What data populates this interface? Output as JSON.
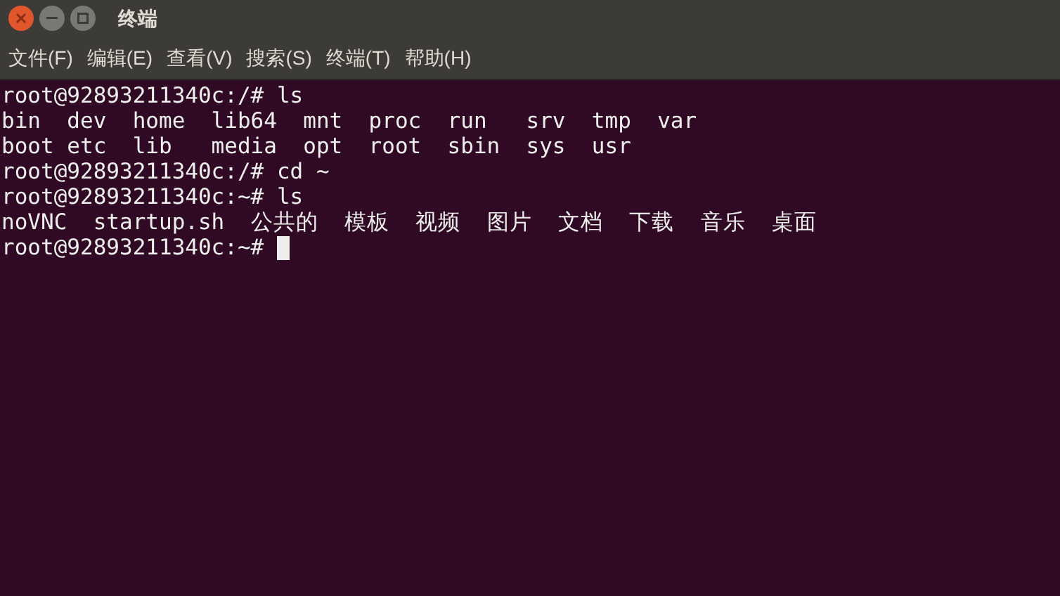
{
  "window": {
    "title": "终端"
  },
  "menu": [
    "文件(F)",
    "编辑(E)",
    "查看(V)",
    "搜索(S)",
    "终端(T)",
    "帮助(H)"
  ],
  "terminal": {
    "lines": [
      "root@92893211340c:/# ls",
      "bin  dev  home  lib64  mnt  proc  run   srv  tmp  var",
      "boot etc  lib   media  opt  root  sbin  sys  usr",
      "root@92893211340c:/# cd ~",
      "root@92893211340c:~# ls",
      "noVNC  startup.sh  公共的  模板  视频  图片  文档  下载  音乐  桌面",
      "root@92893211340c:~# "
    ],
    "cursor": true
  }
}
